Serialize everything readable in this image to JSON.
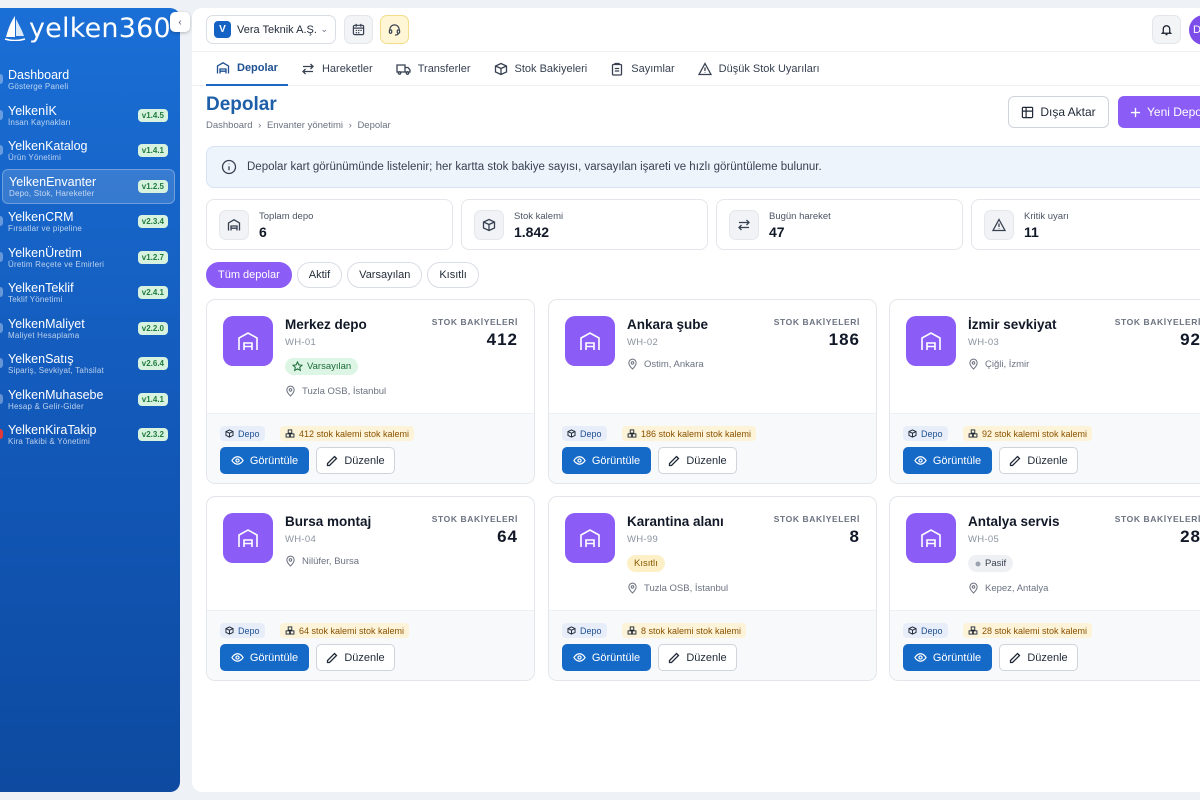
{
  "brand": {
    "name": "yelken360"
  },
  "sidebar": {
    "items": [
      {
        "title": "Dashboard",
        "subtitle": "Gösterge Paneli",
        "version": ""
      },
      {
        "title": "YelkenİK",
        "subtitle": "İnsan Kaynakları",
        "version": "v1.4.5"
      },
      {
        "title": "YelkenKatalog",
        "subtitle": "Ürün Yönetimi",
        "version": "v1.4.1"
      },
      {
        "title": "YelkenEnvanter",
        "subtitle": "Depo, Stok, Hareketler",
        "version": "v1.2.5",
        "active": true
      },
      {
        "title": "YelkenCRM",
        "subtitle": "Fırsatlar ve pipeline",
        "version": "v2.3.4"
      },
      {
        "title": "YelkenÜretim",
        "subtitle": "Üretim Reçete ve Emirleri",
        "version": "v1.2.7"
      },
      {
        "title": "YelkenTeklif",
        "subtitle": "Teklif Yönetimi",
        "version": "v2.4.1"
      },
      {
        "title": "YelkenMaliyet",
        "subtitle": "Maliyet Hesaplama",
        "version": "v2.2.0"
      },
      {
        "title": "YelkenSatış",
        "subtitle": "Sipariş, Sevkiyat, Tahsilat",
        "version": "v2.6.4"
      },
      {
        "title": "YelkenMuhasebe",
        "subtitle": "Hesap & Gelir-Gider",
        "version": "v1.4.1"
      },
      {
        "title": "YelkenKiraTakip",
        "subtitle": "Kira Takibi & Yönetimi",
        "version": "v2.3.2"
      }
    ]
  },
  "topbar": {
    "org_initial": "V",
    "org_name": "Vera Teknik A.Ş."
  },
  "tabs": [
    {
      "label": "Depolar",
      "icon": "warehouse-icon",
      "active": true
    },
    {
      "label": "Hareketler",
      "icon": "arrows-icon"
    },
    {
      "label": "Transferler",
      "icon": "truck-icon"
    },
    {
      "label": "Stok Bakiyeleri",
      "icon": "box-icon"
    },
    {
      "label": "Sayımlar",
      "icon": "clipboard-icon"
    },
    {
      "label": "Düşük Stok Uyarıları",
      "icon": "warning-icon"
    }
  ],
  "page": {
    "title": "Depolar",
    "breadcrumb": [
      "Dashboard",
      "›",
      "Envanter yönetimi",
      "›",
      "Depolar"
    ],
    "export_label": "Dışa Aktar",
    "new_label": "Yeni Depo"
  },
  "info": {
    "text": "Depolar kart görünümünde listelenir; her kartta stok bakiye sayısı, varsayılan işareti ve hızlı görüntüleme bulunur."
  },
  "stats": [
    {
      "label": "Toplam depo",
      "value": "6",
      "icon": "warehouse-icon"
    },
    {
      "label": "Stok kalemi",
      "value": "1.842",
      "icon": "box-icon"
    },
    {
      "label": "Bugün hareket",
      "value": "47",
      "icon": "arrows-icon"
    },
    {
      "label": "Kritik uyarı",
      "value": "11",
      "icon": "warning-icon"
    }
  ],
  "filters": [
    {
      "label": "Tüm depolar",
      "active": true
    },
    {
      "label": "Aktif"
    },
    {
      "label": "Varsayılan"
    },
    {
      "label": "Kısıtlı"
    }
  ],
  "card_labels": {
    "stock_label": "STOK BAKİYELERİ",
    "type_tag": "Depo",
    "view_label": "Görüntüle",
    "edit_label": "Düzenle"
  },
  "warehouses": [
    {
      "name": "Merkez depo",
      "code": "WH-01",
      "badge": "Varsayılan",
      "badge_type": "default",
      "location": "Tuzla OSB, İstanbul",
      "stock": "412",
      "stock_tag": "412 stok kalemi stok kalemi"
    },
    {
      "name": "Ankara şube",
      "code": "WH-02",
      "badge": "",
      "badge_type": "",
      "location": "Ostim, Ankara",
      "stock": "186",
      "stock_tag": "186 stok kalemi stok kalemi"
    },
    {
      "name": "İzmir sevkiyat",
      "code": "WH-03",
      "badge": "",
      "badge_type": "",
      "location": "Çiğli, İzmir",
      "stock": "92",
      "stock_tag": "92 stok kalemi stok kalemi"
    },
    {
      "name": "Bursa montaj",
      "code": "WH-04",
      "badge": "",
      "badge_type": "",
      "location": "Nilüfer, Bursa",
      "stock": "64",
      "stock_tag": "64 stok kalemi stok kalemi"
    },
    {
      "name": "Karantina alanı",
      "code": "WH-99",
      "badge": "Kısıtlı",
      "badge_type": "restricted",
      "location": "Tuzla OSB, İstanbul",
      "stock": "8",
      "stock_tag": "8 stok kalemi stok kalemi"
    },
    {
      "name": "Antalya servis",
      "code": "WH-05",
      "badge": "Pasif",
      "badge_type": "passive",
      "location": "Kepez, Antalya",
      "stock": "28",
      "stock_tag": "28 stok kalemi stok kalemi"
    }
  ],
  "colors": {
    "sidebar": "#1462c4",
    "accent": "#8b5cf6",
    "primary_button": "#1569c7",
    "title": "#1d5fa8"
  }
}
